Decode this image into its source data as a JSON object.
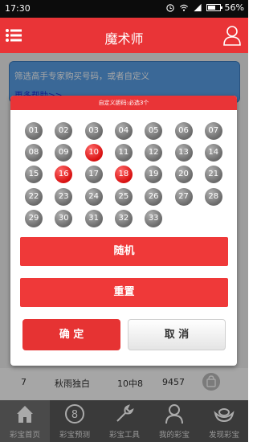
{
  "status": {
    "time": "17:30",
    "battery": "56%"
  },
  "header": {
    "title": "魔术师"
  },
  "banner": {
    "tip": "筛选高手专家购买号码，或者自定义",
    "more_link": "更多帮助>>"
  },
  "background_row": {
    "rank": "7",
    "name": "秋雨独白",
    "hits": "10中8",
    "price": "9457"
  },
  "dialog": {
    "title": "自定义胆码:必选3个",
    "balls": [
      "01",
      "02",
      "03",
      "04",
      "05",
      "06",
      "07",
      "08",
      "09",
      "10",
      "11",
      "12",
      "13",
      "14",
      "15",
      "16",
      "17",
      "18",
      "19",
      "20",
      "21",
      "22",
      "23",
      "24",
      "25",
      "26",
      "27",
      "28",
      "29",
      "30",
      "31",
      "32",
      "33"
    ],
    "selected": [
      "10",
      "16",
      "18"
    ],
    "random_label": "随机",
    "reset_label": "重置",
    "confirm_label": "确 定",
    "cancel_label": "取 消"
  },
  "tabs": [
    {
      "label": "彩宝首页",
      "icon": "home-icon"
    },
    {
      "label": "彩宝预测",
      "icon": "eight-ball-icon"
    },
    {
      "label": "彩宝工具",
      "icon": "wrench-icon"
    },
    {
      "label": "我的彩宝",
      "icon": "person-icon"
    },
    {
      "label": "发现彩宝",
      "icon": "ingot-icon"
    }
  ],
  "colors": {
    "brand": "#e93437",
    "selected_ball": "#d81010",
    "ball": "#7a7a7a"
  }
}
